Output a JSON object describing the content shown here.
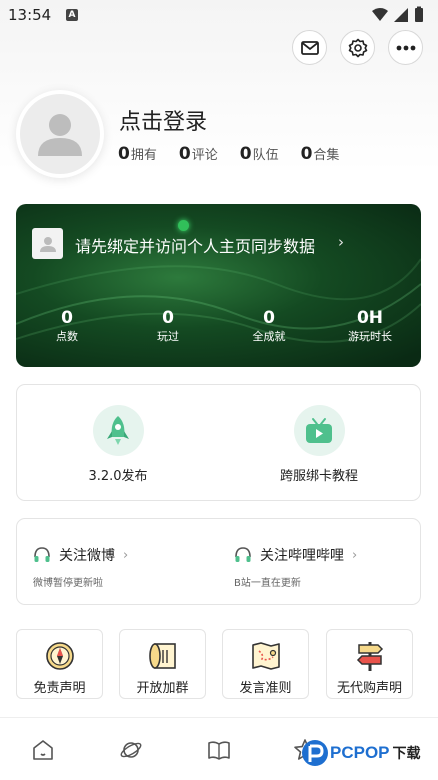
{
  "status_bar": {
    "time": "13:54",
    "notif_letter": "A"
  },
  "header_buttons": {
    "mail": "mail-icon",
    "settings": "gear-icon",
    "more": "more-dots-icon"
  },
  "profile": {
    "login_prompt": "点击登录",
    "stats": [
      {
        "value": "0",
        "label": "拥有"
      },
      {
        "value": "0",
        "label": "评论"
      },
      {
        "value": "0",
        "label": "队伍"
      },
      {
        "value": "0",
        "label": "合集"
      }
    ]
  },
  "bind_card": {
    "prompt": "请先绑定并访问个人主页同步数据",
    "chevron": "›",
    "stats": [
      {
        "value": "0",
        "label": "点数"
      },
      {
        "value": "0",
        "label": "玩过"
      },
      {
        "value": "0",
        "label": "全成就"
      },
      {
        "value": "0H",
        "label": "游玩时长"
      }
    ]
  },
  "features": [
    {
      "label": "3.2.0发布",
      "icon": "rocket-icon"
    },
    {
      "label": "跨服绑卡教程",
      "icon": "tv-play-icon"
    }
  ],
  "follow": [
    {
      "title": "关注微博",
      "subtitle": "微博暂停更新啦",
      "chevron": "›",
      "icon": "headset-icon"
    },
    {
      "title": "关注哔哩哔哩",
      "subtitle": "B站一直在更新",
      "chevron": "›",
      "icon": "headset-icon"
    }
  ],
  "tiles": [
    {
      "label": "免责声明",
      "icon": "compass-icon"
    },
    {
      "label": "开放加群",
      "icon": "scroll-icon"
    },
    {
      "label": "发言准则",
      "icon": "map-icon"
    },
    {
      "label": "无代购声明",
      "icon": "signpost-icon"
    }
  ],
  "bottom_nav": [
    {
      "name": "home",
      "icon": "home-icon"
    },
    {
      "name": "explore",
      "icon": "planet-icon"
    },
    {
      "name": "library",
      "icon": "book-icon"
    },
    {
      "name": "favorites",
      "icon": "star-icon"
    }
  ],
  "watermark": {
    "brand": "PCPOP",
    "suffix": "下载"
  }
}
